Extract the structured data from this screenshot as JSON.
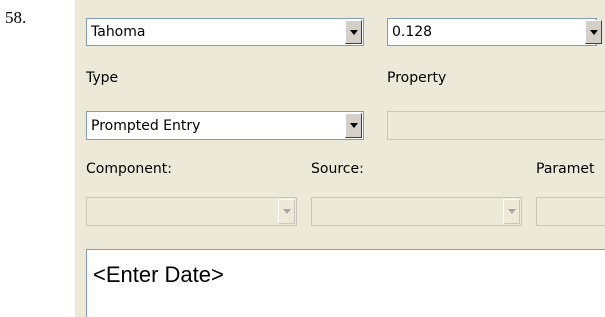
{
  "item_number": "58.",
  "font_row": {
    "font_value": "Tahoma",
    "size_value": "0.128"
  },
  "labels": {
    "type": "Type",
    "property": "Property",
    "component": "Component:",
    "source": "Source:",
    "parameter": "Paramet"
  },
  "type_row": {
    "type_value": "Prompted Entry",
    "property_value": ""
  },
  "selection_row": {
    "component_value": "",
    "source_value": "",
    "parameter_value": ""
  },
  "editor": {
    "content": "<Enter Date>"
  },
  "icons": {
    "dropdown": "chevron-down-icon"
  },
  "colors": {
    "dialog_bg": "#ece9d8",
    "field_border": "#7f9db9",
    "disabled_border": "#c9c7ba"
  }
}
